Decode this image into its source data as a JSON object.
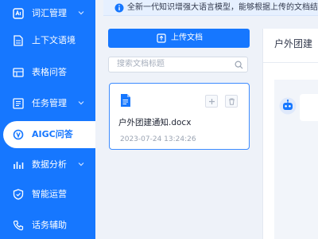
{
  "sidebar": {
    "items": [
      {
        "label": "词汇管理",
        "icon": "vocabulary-icon",
        "has_children": true
      },
      {
        "label": "上下文语境",
        "icon": "context-icon",
        "has_children": false
      },
      {
        "label": "表格问答",
        "icon": "table-icon",
        "has_children": false
      },
      {
        "label": "任务管理",
        "icon": "task-icon",
        "has_children": true
      },
      {
        "label": "AIGC问答",
        "icon": "aigc-icon",
        "has_children": false,
        "active": true
      },
      {
        "label": "数据分析",
        "icon": "chart-icon",
        "has_children": true
      },
      {
        "label": "智能运营",
        "icon": "shield-icon",
        "has_children": false
      },
      {
        "label": "话务辅助",
        "icon": "phone-icon",
        "has_children": false
      }
    ]
  },
  "notice": {
    "text": "全新一代知识增强大语言模型，能够根据上传的文档结合"
  },
  "upload": {
    "label": "上传文档"
  },
  "search": {
    "placeholder": "搜索文档标题"
  },
  "document": {
    "name": "户外团建通知.docx",
    "time": "2023-07-24 13:24:26"
  },
  "right_panel": {
    "title": "户外团建"
  },
  "colors": {
    "primary": "#1677ff",
    "background": "#eef2f9"
  }
}
